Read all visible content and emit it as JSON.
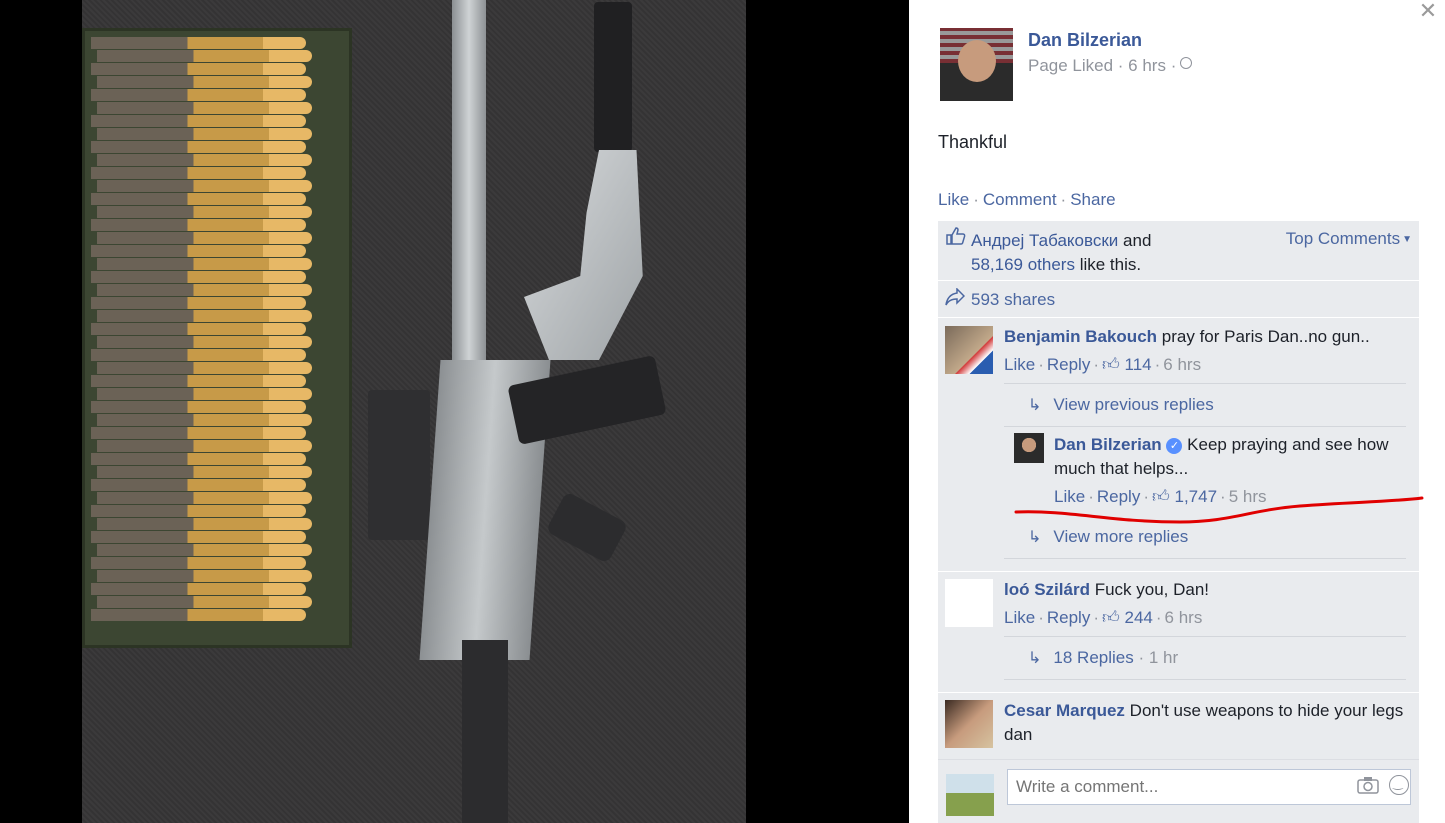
{
  "post": {
    "author": "Dan Bilzerian",
    "meta": "Page Liked · 6 hrs ·",
    "caption": "Thankful",
    "actions": {
      "like": "Like",
      "comment": "Comment",
      "share": "Share"
    }
  },
  "likes": {
    "first_name": "Андреј Табаковски",
    "and": "and",
    "others": "58,169 others",
    "suffix": "like this.",
    "top_comments": "Top Comments"
  },
  "shares": {
    "label": "593 shares"
  },
  "comments": [
    {
      "name": "Benjamin Bakouch",
      "text": "pray for Paris Dan..no gun..",
      "like": "Like",
      "reply": "Reply",
      "likes": "114",
      "time": "6 hrs",
      "view_previous": "View previous replies",
      "reply_item": {
        "name": "Dan Bilzerian",
        "text": "Keep praying and see how much that helps...",
        "like": "Like",
        "reply": "Reply",
        "likes": "1,747",
        "time": "5 hrs"
      },
      "view_more": "View more replies"
    },
    {
      "name": "loó Szilárd",
      "text": "Fuck you, Dan!",
      "like": "Like",
      "reply": "Reply",
      "likes": "244",
      "time": "6 hrs",
      "replies_link": "18 Replies",
      "replies_time": "1 hr"
    },
    {
      "name": "Cesar Marquez",
      "text": "Don't use weapons to hide your legs dan"
    }
  ],
  "composer": {
    "placeholder": "Write a comment..."
  },
  "colors": {
    "link": "#4b67a1",
    "name": "#3b5998",
    "ufi_bg": "#e9ebee",
    "annotation": "#e00000"
  }
}
